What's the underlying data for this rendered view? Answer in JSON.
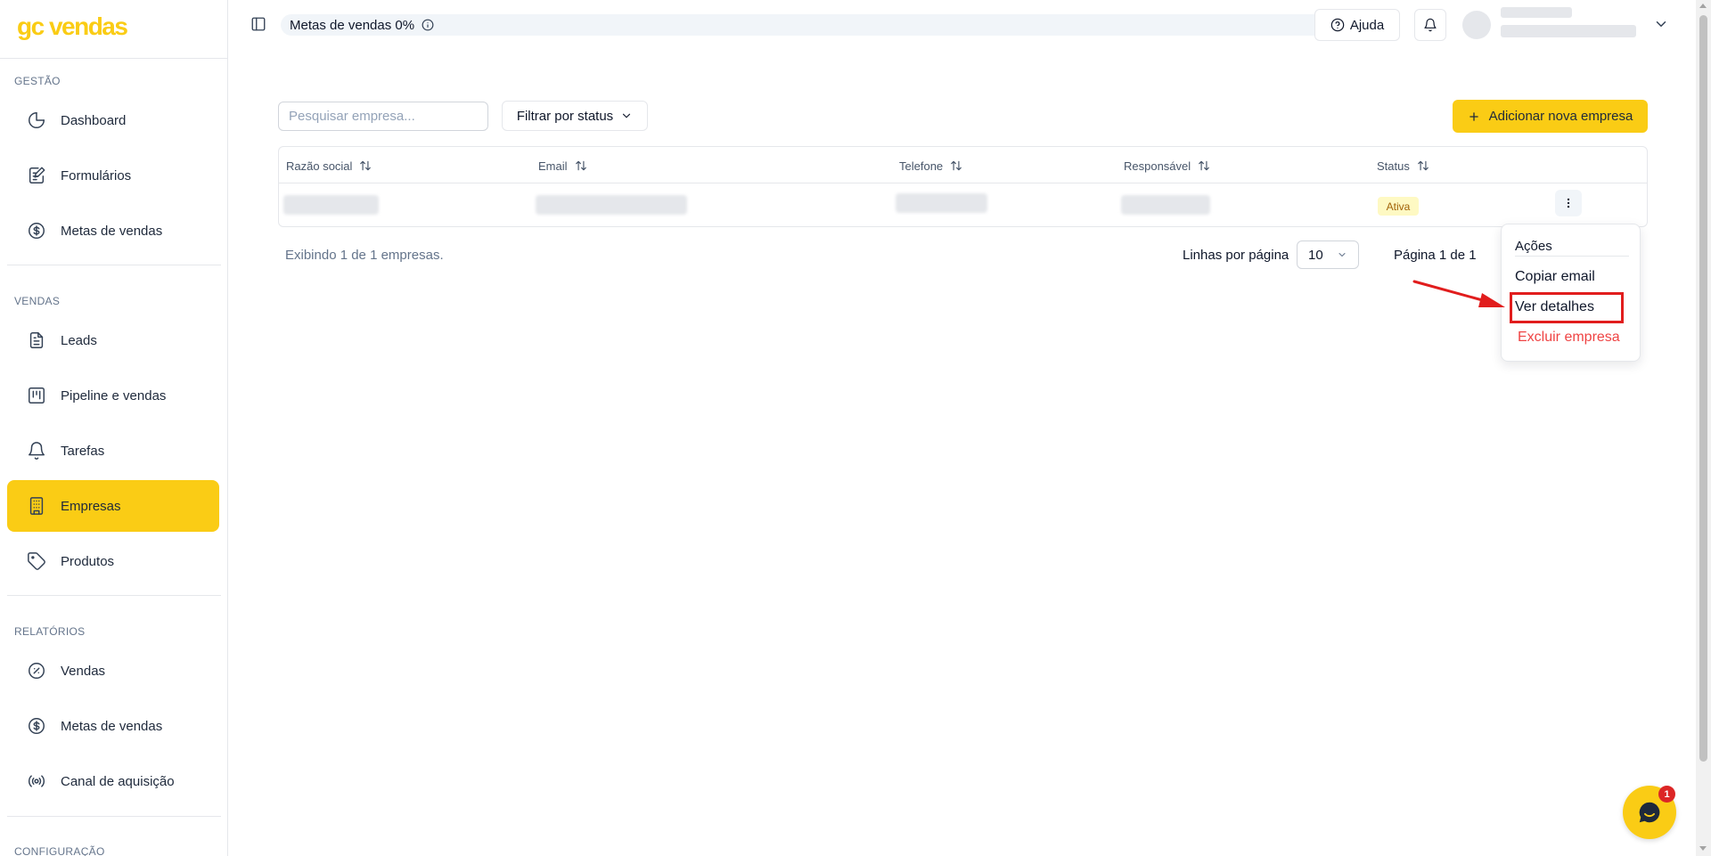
{
  "sidebar": {
    "logo": "gc vendas",
    "sections": {
      "gestao": "GESTÃO",
      "vendas": "VENDAS",
      "relatorios": "RELATÓRIOS",
      "configuracao": "CONFIGURAÇÃO"
    },
    "items": [
      {
        "label": "Dashboard",
        "icon": "pie-chart-icon"
      },
      {
        "label": "Formulários",
        "icon": "form-edit-icon"
      },
      {
        "label": "Metas de vendas",
        "icon": "dollar-circle-icon"
      },
      {
        "label": "Leads",
        "icon": "document-icon"
      },
      {
        "label": "Pipeline e vendas",
        "icon": "kanban-icon"
      },
      {
        "label": "Tarefas",
        "icon": "bell-icon"
      },
      {
        "label": "Empresas",
        "icon": "building-icon",
        "active": true
      },
      {
        "label": "Produtos",
        "icon": "tag-icon"
      },
      {
        "label": "Vendas",
        "icon": "percent-circle-icon"
      },
      {
        "label": "Metas de vendas",
        "icon": "dollar-circle-icon"
      },
      {
        "label": "Canal de aquisição",
        "icon": "radio-signal-icon"
      }
    ]
  },
  "header": {
    "goal_label": "Metas de vendas 0%",
    "help_label": "Ajuda"
  },
  "toolbar": {
    "search_placeholder": "Pesquisar empresa...",
    "filter_label": "Filtrar por status",
    "add_label": "Adicionar nova empresa"
  },
  "table": {
    "columns": [
      "Razão social",
      "Email",
      "Telefone",
      "Responsável",
      "Status"
    ],
    "rows": [
      {
        "status": "Ativa"
      }
    ]
  },
  "footer": {
    "count_text": "Exibindo 1 de 1 empresas.",
    "rows_per_page_label": "Linhas por página",
    "rows_per_page_value": "10",
    "page_info": "Página 1 de 1"
  },
  "actions_menu": {
    "title": "Ações",
    "items": [
      "Copiar email",
      "Ver detalhes",
      "Excluir empresa"
    ]
  },
  "chat": {
    "badge_count": "1"
  },
  "colors": {
    "accent": "#facc15",
    "danger": "#ef4444",
    "annotation": "#e11d1d"
  }
}
